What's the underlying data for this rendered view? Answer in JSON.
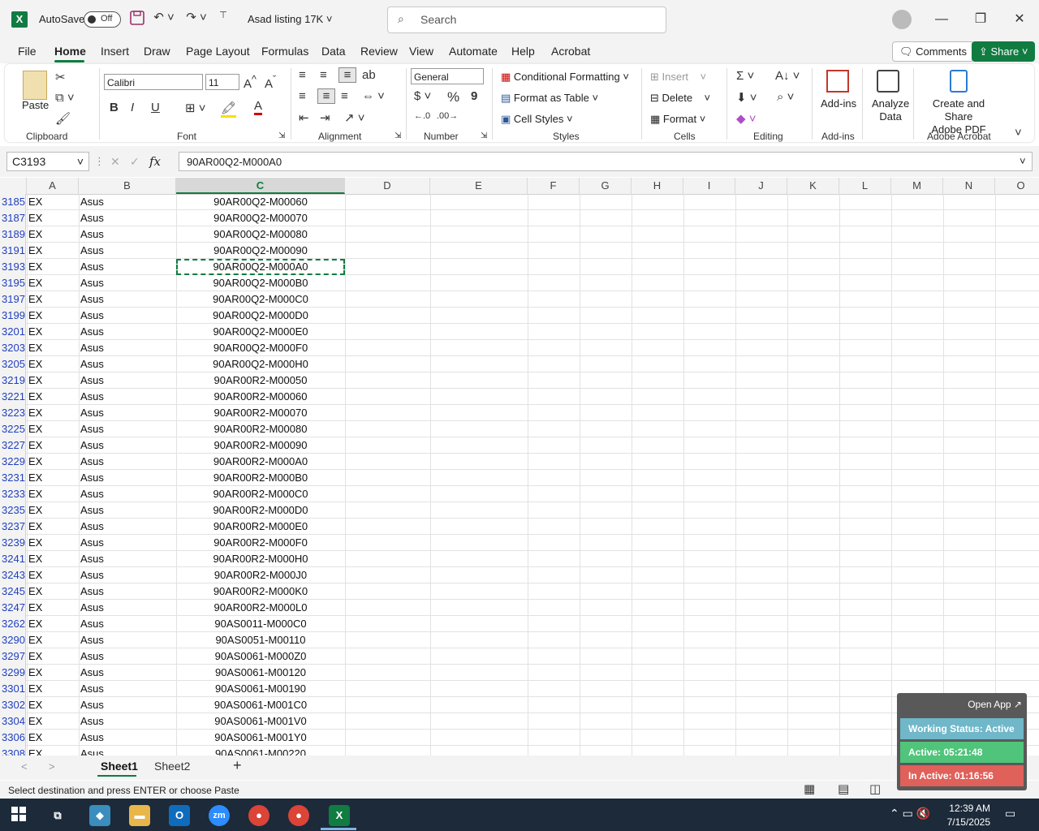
{
  "titlebar": {
    "app_logo": "X",
    "autosave_label": "AutoSave",
    "autosave_state": "Off",
    "filename": "Asad listing 17K",
    "search_placeholder": "Search"
  },
  "menu": {
    "tabs": [
      "File",
      "Home",
      "Insert",
      "Draw",
      "Page Layout",
      "Formulas",
      "Data",
      "Review",
      "View",
      "Automate",
      "Help",
      "Acrobat"
    ],
    "active_tab": "Home",
    "comments_label": "Comments",
    "share_label": "Share"
  },
  "ribbon": {
    "clipboard": {
      "paste": "Paste",
      "label": "Clipboard"
    },
    "font": {
      "name": "Calibri",
      "size": "11",
      "label": "Font",
      "bold": "B",
      "italic": "I",
      "underline": "U"
    },
    "alignment": {
      "label": "Alignment"
    },
    "number": {
      "format": "General",
      "label": "Number",
      "currency": "$",
      "percent": "%",
      "comma": "9"
    },
    "styles": {
      "conditional": "Conditional Formatting",
      "table": "Format as Table",
      "cell_styles": "Cell Styles",
      "label": "Styles"
    },
    "cells": {
      "insert": "Insert",
      "delete": "Delete",
      "format": "Format",
      "label": "Cells"
    },
    "editing": {
      "label": "Editing"
    },
    "addins": {
      "button": "Add-ins",
      "label": "Add-ins"
    },
    "analyze": {
      "line1": "Analyze",
      "line2": "Data"
    },
    "acrobat": {
      "line1": "Create and Share",
      "line2": "Adobe PDF",
      "label": "Adobe Acrobat"
    }
  },
  "formula_bar": {
    "name_box": "C3193",
    "fx": "fx",
    "value": "90AR00Q2-M000A0"
  },
  "columns": [
    "A",
    "B",
    "C",
    "D",
    "E",
    "F",
    "G",
    "H",
    "I",
    "J",
    "K",
    "L",
    "M",
    "N",
    "O"
  ],
  "selected_column": "C",
  "rows": [
    {
      "n": "3185",
      "a": "EX",
      "b": "Asus",
      "c": "90AR00Q2-M00060"
    },
    {
      "n": "3187",
      "a": "EX",
      "b": "Asus",
      "c": "90AR00Q2-M00070"
    },
    {
      "n": "3189",
      "a": "EX",
      "b": "Asus",
      "c": "90AR00Q2-M00080"
    },
    {
      "n": "3191",
      "a": "EX",
      "b": "Asus",
      "c": "90AR00Q2-M00090"
    },
    {
      "n": "3193",
      "a": "EX",
      "b": "Asus",
      "c": "90AR00Q2-M000A0"
    },
    {
      "n": "3195",
      "a": "EX",
      "b": "Asus",
      "c": "90AR00Q2-M000B0"
    },
    {
      "n": "3197",
      "a": "EX",
      "b": "Asus",
      "c": "90AR00Q2-M000C0"
    },
    {
      "n": "3199",
      "a": "EX",
      "b": "Asus",
      "c": "90AR00Q2-M000D0"
    },
    {
      "n": "3201",
      "a": "EX",
      "b": "Asus",
      "c": "90AR00Q2-M000E0"
    },
    {
      "n": "3203",
      "a": "EX",
      "b": "Asus",
      "c": "90AR00Q2-M000F0"
    },
    {
      "n": "3205",
      "a": "EX",
      "b": "Asus",
      "c": "90AR00Q2-M000H0"
    },
    {
      "n": "3219",
      "a": "EX",
      "b": "Asus",
      "c": "90AR00R2-M00050"
    },
    {
      "n": "3221",
      "a": "EX",
      "b": "Asus",
      "c": "90AR00R2-M00060"
    },
    {
      "n": "3223",
      "a": "EX",
      "b": "Asus",
      "c": "90AR00R2-M00070"
    },
    {
      "n": "3225",
      "a": "EX",
      "b": "Asus",
      "c": "90AR00R2-M00080"
    },
    {
      "n": "3227",
      "a": "EX",
      "b": "Asus",
      "c": "90AR00R2-M00090"
    },
    {
      "n": "3229",
      "a": "EX",
      "b": "Asus",
      "c": "90AR00R2-M000A0"
    },
    {
      "n": "3231",
      "a": "EX",
      "b": "Asus",
      "c": "90AR00R2-M000B0"
    },
    {
      "n": "3233",
      "a": "EX",
      "b": "Asus",
      "c": "90AR00R2-M000C0"
    },
    {
      "n": "3235",
      "a": "EX",
      "b": "Asus",
      "c": "90AR00R2-M000D0"
    },
    {
      "n": "3237",
      "a": "EX",
      "b": "Asus",
      "c": "90AR00R2-M000E0"
    },
    {
      "n": "3239",
      "a": "EX",
      "b": "Asus",
      "c": "90AR00R2-M000F0"
    },
    {
      "n": "3241",
      "a": "EX",
      "b": "Asus",
      "c": "90AR00R2-M000H0"
    },
    {
      "n": "3243",
      "a": "EX",
      "b": "Asus",
      "c": "90AR00R2-M000J0"
    },
    {
      "n": "3245",
      "a": "EX",
      "b": "Asus",
      "c": "90AR00R2-M000K0"
    },
    {
      "n": "3247",
      "a": "EX",
      "b": "Asus",
      "c": "90AR00R2-M000L0"
    },
    {
      "n": "3262",
      "a": "EX",
      "b": "Asus",
      "c": "90AS0011-M000C0"
    },
    {
      "n": "3290",
      "a": "EX",
      "b": "Asus",
      "c": "90AS0051-M00110"
    },
    {
      "n": "3297",
      "a": "EX",
      "b": "Asus",
      "c": "90AS0061-M000Z0"
    },
    {
      "n": "3299",
      "a": "EX",
      "b": "Asus",
      "c": "90AS0061-M00120"
    },
    {
      "n": "3301",
      "a": "EX",
      "b": "Asus",
      "c": "90AS0061-M00190"
    },
    {
      "n": "3302",
      "a": "EX",
      "b": "Asus",
      "c": "90AS0061-M001C0"
    },
    {
      "n": "3304",
      "a": "EX",
      "b": "Asus",
      "c": "90AS0061-M001V0"
    },
    {
      "n": "3306",
      "a": "EX",
      "b": "Asus",
      "c": "90AS0061-M001Y0"
    },
    {
      "n": "3308",
      "a": "EX",
      "b": "Asus",
      "c": "90AS0061-M00220"
    }
  ],
  "selected_row": "3193",
  "sheets": [
    "Sheet1",
    "Sheet2"
  ],
  "active_sheet": "Sheet1",
  "status": {
    "message": "Select destination and press ENTER or choose Paste"
  },
  "widget": {
    "open_app": "Open App ↗",
    "working_status": "Working Status: Active",
    "active": "Active: 05:21:48",
    "inactive": "In Active: 01:16:56",
    "colors": {
      "status": "#6fb7c9",
      "active": "#4fc47a",
      "inactive": "#e0605a"
    }
  },
  "taskbar": {
    "time": "12:39 AM",
    "date": "7/15/2025"
  },
  "colors": {
    "accent": "#107c41",
    "row_number": "#1f3fbf"
  }
}
